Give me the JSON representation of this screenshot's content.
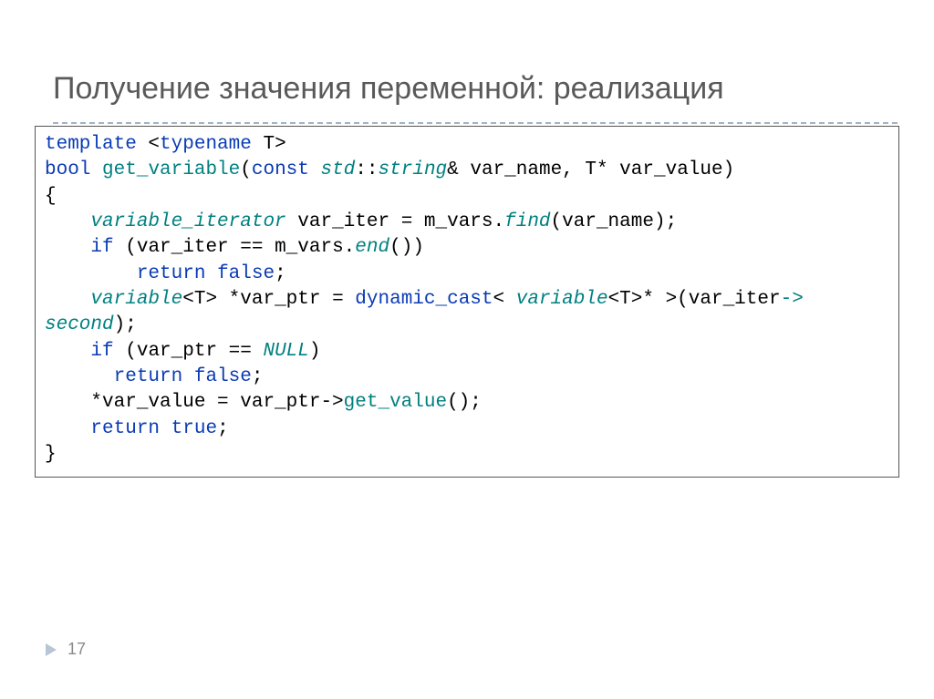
{
  "slide": {
    "title": "Получение значения переменной: реализация",
    "page_number": "17"
  },
  "code": {
    "l1_kw_template": "template",
    "l1_lt": " <",
    "l1_kw_typename": "typename",
    "l1_t_gt": " T>",
    "l2_kw_bool": "bool",
    "l2_sp": " ",
    "l2_fn": "get_variable",
    "l2_p1": "(",
    "l2_kw_const": "const",
    "l2_sp2": " ",
    "l2_type_std": "std",
    "l2_cc": "::",
    "l2_type_string": "string",
    "l2_rest": "& var_name, T* var_value)",
    "l3": "{",
    "l4_indent": "    ",
    "l4_type": "variable_iterator",
    "l4_mid": " var_iter = m_vars.",
    "l4_fn": "find",
    "l4_rest": "(var_name);",
    "l5_indent": "    ",
    "l5_kw_if": "if",
    "l5_mid": " (var_iter == m_vars.",
    "l5_fn": "end",
    "l5_rest": "())",
    "l6_indent": "        ",
    "l6_kw_return": "return",
    "l6_sp": " ",
    "l6_kw_false": "false",
    "l6_semi": ";",
    "l7_indent": "    ",
    "l7_type1": "variable",
    "l7_t1": "<T> *var_ptr = ",
    "l7_kw_dc": "dynamic_cast",
    "l7_lt2": "< ",
    "l7_type2": "variable",
    "l7_t2": "<T>* >(var_iter",
    "l7_arrow": "->",
    "l8_fn": "second",
    "l8_rest": ");",
    "l9_indent": "    ",
    "l9_kw_if": "if",
    "l9_mid": " (var_ptr == ",
    "l9_null": "NULL",
    "l9_rest": ")",
    "l10_indent": "      ",
    "l10_kw_return": "return",
    "l10_sp": " ",
    "l10_kw_false": "false",
    "l10_semi": ";",
    "l11_indent": "    *var_value = var_ptr->",
    "l11_fn": "get_value",
    "l11_rest": "();",
    "l12_indent": "    ",
    "l12_kw_return": "return",
    "l12_sp": " ",
    "l12_kw_true": "true",
    "l12_semi": ";",
    "l13": "}"
  }
}
